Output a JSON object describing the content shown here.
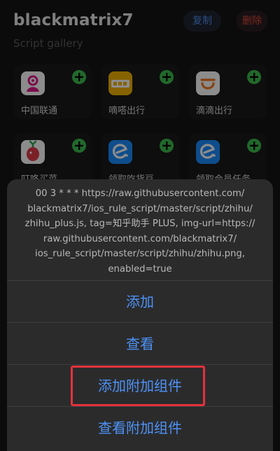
{
  "header": {
    "title": "blackmatrix7",
    "subtitle": "Script gallery",
    "copy_label": "复制",
    "delete_label": "删除"
  },
  "apps": [
    {
      "name": "中国联通",
      "icon": "china-unicom-icon"
    },
    {
      "name": "嘀嗒出行",
      "icon": "dida-icon"
    },
    {
      "name": "滴滴出行",
      "icon": "didi-icon"
    },
    {
      "name": "叮咚买菜",
      "icon": "dingdong-icon"
    },
    {
      "name": "领取吃货豆",
      "icon": "eleme-icon"
    },
    {
      "name": "领取会员任务",
      "icon": "eleme-icon"
    }
  ],
  "action_sheet": {
    "message": "00 3 * * * https://raw.githubusercontent.com/blackmatrix7/ios_rule_script/master/script/zhihu/zhihu_plus.js, tag=知乎助手 PLUS, img-url=https://raw.githubusercontent.com/blackmatrix7/ios_rule_script/master/script/zhihu/zhihu.png, enabled=true",
    "message_lines": [
      "00 3 * * * https://raw.githubusercontent.com/",
      "blackmatrix7/ios_rule_script/master/script/zhihu/",
      "zhihu_plus.js, tag=知乎助手 PLUS, img-url=https://",
      "raw.githubusercontent.com/blackmatrix7/",
      "ios_rule_script/master/script/zhihu/zhihu.png,",
      "enabled=true"
    ],
    "actions": [
      "添加",
      "查看",
      "添加附加组件",
      "查看附加组件"
    ]
  },
  "colors": {
    "action_blue": "#4d92f7",
    "add_green": "#3dbd4f",
    "highlight_red": "#e5313d"
  }
}
